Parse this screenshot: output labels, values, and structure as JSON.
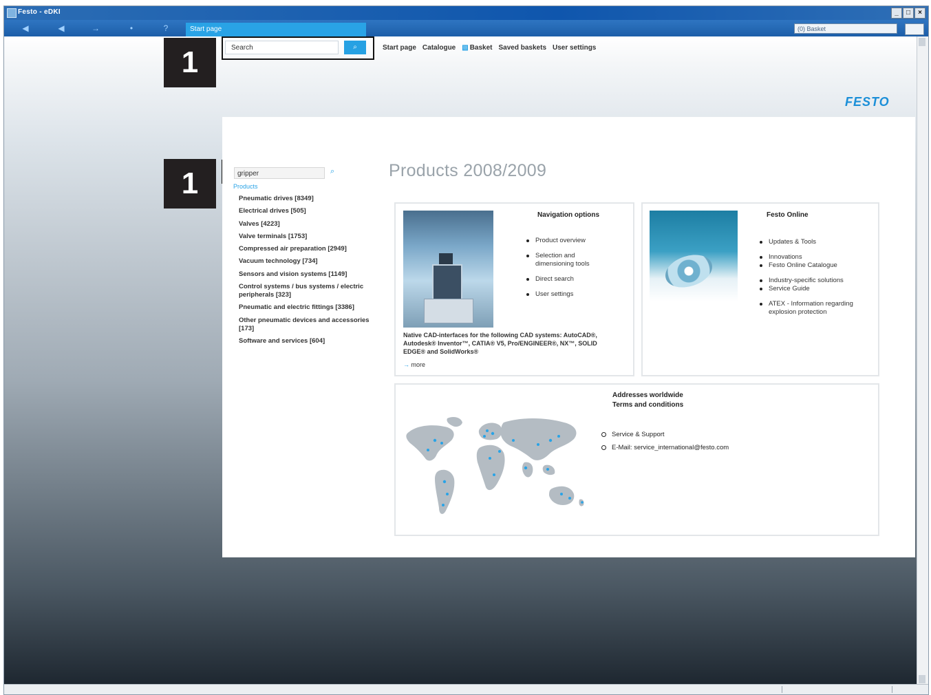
{
  "window": {
    "title": "Festo - eDKI",
    "controls": [
      "_",
      "□",
      "×"
    ]
  },
  "toolbar": {
    "buttons": [
      "◀",
      "◀",
      "→",
      "•",
      "?"
    ],
    "tab_label": "Start page",
    "basket_label": "(0) Basket"
  },
  "header": {
    "search_placeholder": "Search",
    "search_button": "⌕",
    "nav": [
      "Start page",
      "Catalogue",
      "Basket",
      "Saved baskets",
      "User settings"
    ],
    "logo": "FESTO"
  },
  "callouts": [
    "1",
    "1"
  ],
  "sidebar": {
    "search_value": "gripper",
    "search_icon": "⌕",
    "products_label": "Products",
    "categories": [
      "Pneumatic drives [8349]",
      "Electrical drives [505]",
      "Valves [4223]",
      "Valve terminals [1753]",
      "Compressed air preparation [2949]",
      "Vacuum technology [734]",
      "Sensors and vision systems [1149]",
      "Control systems / bus systems / electric peripherals [323]",
      "Pneumatic and electric fittings [3386]",
      "Other pneumatic devices and accessories [173]",
      "Software and services [604]"
    ]
  },
  "main": {
    "title": "Products 2008/2009",
    "navigation": {
      "heading": "Navigation options",
      "items": [
        "Product overview",
        "Selection and dimensioning tools",
        "Direct search",
        "User settings"
      ],
      "cad_text": "Native CAD-interfaces for the following CAD systems: AutoCAD®, Autodesk® Inventor™, CATIA® V5, Pro/ENGINEER®, NX™, SOLID EDGE® and SolidWorks®",
      "more_label": "more"
    },
    "festo_online": {
      "heading": "Festo Online",
      "items": [
        "Updates & Tools",
        "Innovations",
        "Festo Online Catalogue",
        "Industry-specific solutions",
        "Service Guide",
        "ATEX - Information regarding explosion protection"
      ]
    },
    "addresses": {
      "heading_1": "Addresses worldwide",
      "heading_2": "Terms and conditions",
      "items": [
        "Service & Support",
        "E-Mail: service_international@festo.com"
      ]
    }
  },
  "colors": {
    "accent": "#29a3e6",
    "logo": "#1b8fd8",
    "titlebar": "#0f56ad"
  }
}
